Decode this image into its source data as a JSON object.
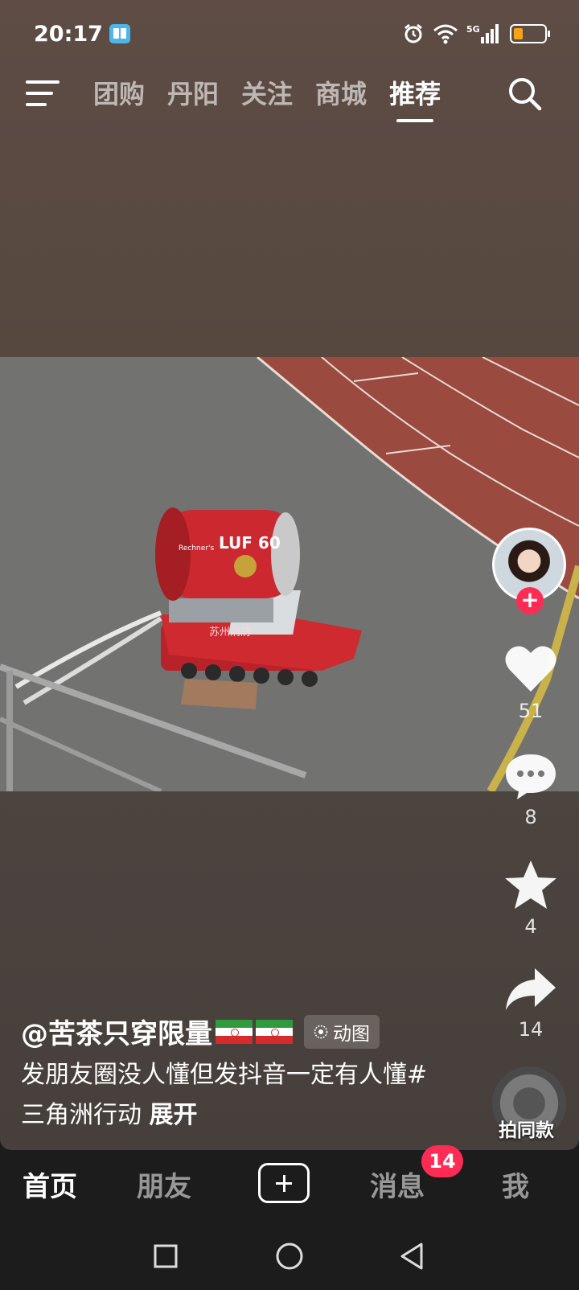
{
  "status_bar": {
    "time": "20:17",
    "network": "5G"
  },
  "top_nav": {
    "tabs": [
      "团购",
      "丹阳",
      "关注",
      "商城",
      "推荐"
    ],
    "active_tab": "推荐"
  },
  "video": {
    "machine_label": "LUF 60",
    "brand_label": "Rechner's",
    "side_label": "苏州消防"
  },
  "actions": {
    "likes": "51",
    "comments": "8",
    "favorites": "4",
    "shares": "14",
    "music_label": "拍同款"
  },
  "caption": {
    "author": "@苦茶只穿限量",
    "chip": "动图",
    "text": "发朋友圈没人懂但发抖音一定有人懂#三角洲行动",
    "more": "展开"
  },
  "bottom_nav": {
    "home": "首页",
    "friends": "朋友",
    "messages": "消息",
    "messages_badge": "14",
    "me": "我"
  },
  "colors": {
    "accent": "#fe2c55",
    "battery": "#f7a21b"
  }
}
